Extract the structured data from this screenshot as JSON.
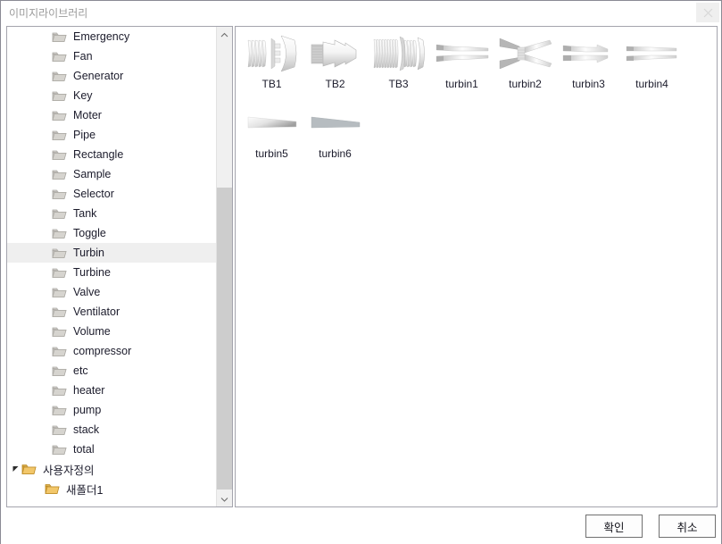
{
  "window": {
    "title": "이미지라이브러리",
    "close_icon": "close-icon"
  },
  "tree": {
    "items": [
      {
        "label": "Emergency",
        "indent": 56,
        "icon": "folder-gray-icon",
        "selected": false,
        "twisty": ""
      },
      {
        "label": "Fan",
        "indent": 56,
        "icon": "folder-gray-icon",
        "selected": false,
        "twisty": ""
      },
      {
        "label": "Generator",
        "indent": 56,
        "icon": "folder-gray-icon",
        "selected": false,
        "twisty": ""
      },
      {
        "label": "Key",
        "indent": 56,
        "icon": "folder-gray-icon",
        "selected": false,
        "twisty": ""
      },
      {
        "label": "Moter",
        "indent": 56,
        "icon": "folder-gray-icon",
        "selected": false,
        "twisty": ""
      },
      {
        "label": "Pipe",
        "indent": 56,
        "icon": "folder-gray-icon",
        "selected": false,
        "twisty": ""
      },
      {
        "label": "Rectangle",
        "indent": 56,
        "icon": "folder-gray-icon",
        "selected": false,
        "twisty": ""
      },
      {
        "label": "Sample",
        "indent": 56,
        "icon": "folder-gray-icon",
        "selected": false,
        "twisty": ""
      },
      {
        "label": "Selector",
        "indent": 56,
        "icon": "folder-gray-icon",
        "selected": false,
        "twisty": ""
      },
      {
        "label": "Tank",
        "indent": 56,
        "icon": "folder-gray-icon",
        "selected": false,
        "twisty": ""
      },
      {
        "label": "Toggle",
        "indent": 56,
        "icon": "folder-gray-icon",
        "selected": false,
        "twisty": ""
      },
      {
        "label": "Turbin",
        "indent": 56,
        "icon": "folder-gray-icon",
        "selected": true,
        "twisty": ""
      },
      {
        "label": "Turbine",
        "indent": 56,
        "icon": "folder-gray-icon",
        "selected": false,
        "twisty": ""
      },
      {
        "label": "Valve",
        "indent": 56,
        "icon": "folder-gray-icon",
        "selected": false,
        "twisty": ""
      },
      {
        "label": "Ventilator",
        "indent": 56,
        "icon": "folder-gray-icon",
        "selected": false,
        "twisty": ""
      },
      {
        "label": "Volume",
        "indent": 56,
        "icon": "folder-gray-icon",
        "selected": false,
        "twisty": ""
      },
      {
        "label": "compressor",
        "indent": 56,
        "icon": "folder-gray-icon",
        "selected": false,
        "twisty": ""
      },
      {
        "label": "etc",
        "indent": 56,
        "icon": "folder-gray-icon",
        "selected": false,
        "twisty": ""
      },
      {
        "label": "heater",
        "indent": 56,
        "icon": "folder-gray-icon",
        "selected": false,
        "twisty": ""
      },
      {
        "label": "pump",
        "indent": 56,
        "icon": "folder-gray-icon",
        "selected": false,
        "twisty": ""
      },
      {
        "label": "stack",
        "indent": 56,
        "icon": "folder-gray-icon",
        "selected": false,
        "twisty": ""
      },
      {
        "label": "total",
        "indent": 56,
        "icon": "folder-gray-icon",
        "selected": false,
        "twisty": ""
      },
      {
        "label": "사용자정의",
        "indent": 22,
        "icon": "folder-yellow-icon",
        "selected": false,
        "twisty": "expanded"
      },
      {
        "label": "새폴더1",
        "indent": 48,
        "icon": "folder-yellow-icon",
        "selected": false,
        "twisty": ""
      }
    ],
    "scrollbar": {
      "up_arrow_icon": "chevron-up-icon",
      "down_arrow_icon": "chevron-down-icon"
    }
  },
  "content": {
    "thumbnails": [
      {
        "label": "TB1",
        "icon": "turbine-bladed-rotor-icon"
      },
      {
        "label": "TB2",
        "icon": "turbine-cone-icon"
      },
      {
        "label": "TB3",
        "icon": "turbine-multistage-icon"
      },
      {
        "label": "turbin1",
        "icon": "turbine-split-nozzle-icon"
      },
      {
        "label": "turbin2",
        "icon": "turbine-hourglass-icon"
      },
      {
        "label": "turbin3",
        "icon": "turbine-fork-icon"
      },
      {
        "label": "turbin4",
        "icon": "turbine-thin-fork-icon"
      },
      {
        "label": "turbin5",
        "icon": "turbine-wedge-light-icon"
      },
      {
        "label": "turbin6",
        "icon": "turbine-wedge-solid-icon"
      }
    ]
  },
  "footer": {
    "ok_label": "확인",
    "cancel_label": "취소"
  },
  "colors": {
    "selection": "#efefef",
    "border": "#a4a4ad",
    "title_text": "#9b9b9b",
    "scroll_thumb": "#cdcdcd",
    "folder_yellow": "#e8b962"
  }
}
